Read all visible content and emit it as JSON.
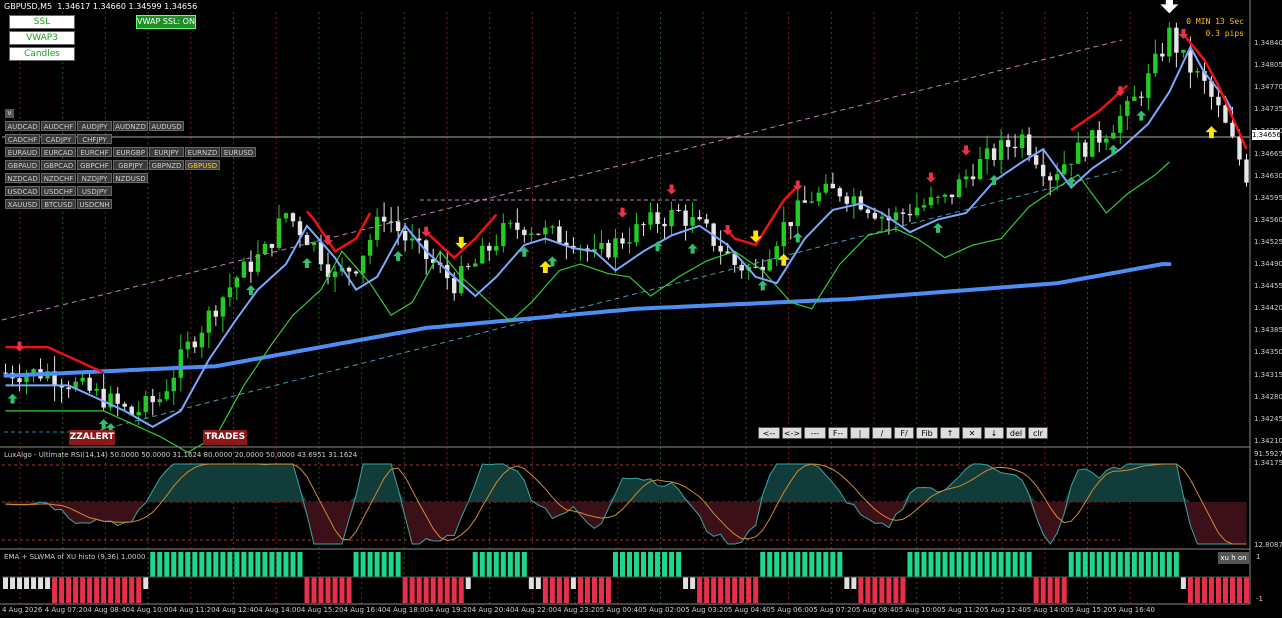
{
  "window": {
    "title": "GBPUSD,M5",
    "ohlc": "1.34617 1.34660 1.34599 1.34656"
  },
  "left_buttons": [
    "SSL",
    "VWAP3",
    "Candles"
  ],
  "vwap_button": "VWAP SSL: ON",
  "collapse_button": "v",
  "pair_rows": [
    [
      "AUDCAD",
      "AUDCHF",
      "AUDJPY",
      "AUDNZD",
      "AUDUSD"
    ],
    [
      "CADCHF",
      "CADJPY",
      "CHFJPY"
    ],
    [
      "EURAUD",
      "EURCAD",
      "EURCHF",
      "EURGBP",
      "EURJPY",
      "EURNZD",
      "EURUSD"
    ],
    [
      "GBPAUD",
      "GBPCAD",
      "GBPCHF",
      "GBPJPY",
      "GBPNZD",
      "GBPUSD"
    ],
    [
      "NZDCAD",
      "NZDCHF",
      "NZDJPY",
      "NZDUSD"
    ],
    [
      "USDCAD",
      "USDCHF",
      "USDJPY"
    ],
    [
      "XAUUSD",
      "BTCUSD",
      "USDCNH"
    ]
  ],
  "active_pair": "GBPUSD",
  "timer": {
    "line1": "0 MIN 13 Sec",
    "line2": "0.3 pips"
  },
  "alert_buttons": [
    "ZZALERT",
    "TRADES"
  ],
  "toolbar": [
    "<--",
    "<->",
    "---",
    "F--",
    "|",
    "/",
    "F/",
    "Fib",
    "↑",
    "✕",
    "↓",
    "del",
    "clr"
  ],
  "price_axis": {
    "labels": [
      "1.34840",
      "1.34805",
      "1.34770",
      "1.34735",
      "1.34700",
      "1.34665",
      "1.34630",
      "1.34595",
      "1.34560",
      "1.34525",
      "1.34490",
      "1.34455",
      "1.34420",
      "1.34385",
      "1.34350",
      "1.34315",
      "1.34280",
      "1.34245",
      "1.34210",
      "1.34175"
    ],
    "current": "1.34656"
  },
  "time_axis": [
    "4 Aug 2026",
    "4 Aug 07:20",
    "4 Aug 08:40",
    "4 Aug 10:00",
    "4 Aug 11:20",
    "4 Aug 12:40",
    "4 Aug 14:00",
    "4 Aug 15:20",
    "4 Aug 16:40",
    "4 Aug 18:00",
    "4 Aug 19:20",
    "4 Aug 20:40",
    "4 Aug 22:00",
    "4 Aug 23:20",
    "5 Aug 00:40",
    "5 Aug 02:00",
    "5 Aug 03:20",
    "5 Aug 04:40",
    "5 Aug 06:00",
    "5 Aug 07:20",
    "5 Aug 08:40",
    "5 Aug 10:00",
    "5 Aug 11:20",
    "5 Aug 12:40",
    "5 Aug 14:00",
    "5 Aug 15:20",
    "5 Aug 16:40"
  ],
  "rsi_panel": {
    "title": "LuxAlgo - Ultimate RSI(14,14) 50.0000 50.0000 31.1624 80.0000 20.0000 50.0000 43.6951 31.1624",
    "max_label": "91.5927",
    "min_label": "12.8087"
  },
  "histo_panel": {
    "title": "EMA + SLWMA of XU histo (9,36) 1.0000",
    "toggle": "xu h on",
    "max_label": "1",
    "min_label": "-1"
  },
  "colors": {
    "bg": "#000000",
    "bull": "#22cc22",
    "bear": "#e6e6e6",
    "ssl": "#ee1111",
    "vwap": "#4d8ef5",
    "ema": "#33cc33",
    "histo_up": "#1fd68f",
    "histo_down": "#e8304a",
    "histo_neutral": "#e0e0e0"
  },
  "chart_data": {
    "type": "candlestick",
    "symbol": "GBPUSD",
    "timeframe": "M5",
    "ylim": [
      1.34175,
      1.34855
    ],
    "close_path": [
      [
        0,
        1.3429
      ],
      [
        6,
        1.3429
      ],
      [
        10,
        1.3427
      ],
      [
        14,
        1.3425
      ],
      [
        18,
        1.34225
      ],
      [
        22,
        1.3425
      ],
      [
        26,
        1.3433
      ],
      [
        30,
        1.34395
      ],
      [
        33,
        1.3444
      ],
      [
        37,
        1.3448
      ],
      [
        40,
        1.3454
      ],
      [
        44,
        1.3449
      ],
      [
        47,
        1.3444
      ],
      [
        50,
        1.3446
      ],
      [
        54,
        1.3454
      ],
      [
        57,
        1.345
      ],
      [
        60,
        1.3447
      ],
      [
        64,
        1.3443
      ],
      [
        67,
        1.3446
      ],
      [
        71,
        1.3451
      ],
      [
        74,
        1.3452
      ],
      [
        78,
        1.34505
      ],
      [
        81,
        1.345
      ],
      [
        84,
        1.3447
      ],
      [
        88,
        1.345
      ],
      [
        92,
        1.34525
      ],
      [
        96,
        1.3454
      ],
      [
        100,
        1.3451
      ],
      [
        104,
        1.3446
      ],
      [
        107,
        1.3445
      ],
      [
        111,
        1.3452
      ],
      [
        115,
        1.34565
      ],
      [
        119,
        1.34575
      ],
      [
        122,
        1.3456
      ],
      [
        126,
        1.3453
      ],
      [
        130,
        1.3455
      ],
      [
        134,
        1.3456
      ],
      [
        138,
        1.3461
      ],
      [
        142,
        1.3464
      ],
      [
        145,
        1.3466
      ],
      [
        149,
        1.346
      ],
      [
        152,
        1.3463
      ],
      [
        156,
        1.3466
      ],
      [
        160,
        1.347
      ],
      [
        163,
        1.3475
      ],
      [
        166,
        1.3482
      ],
      [
        168,
        1.3478
      ],
      [
        171,
        1.3474
      ],
      [
        173,
        1.347
      ],
      [
        175,
        1.3465
      ],
      [
        177,
        1.346
      ]
    ],
    "vwap_path": [
      [
        0,
        1.34285
      ],
      [
        30,
        1.343
      ],
      [
        60,
        1.3436
      ],
      [
        90,
        1.3439
      ],
      [
        120,
        1.34405
      ],
      [
        150,
        1.3443
      ],
      [
        165,
        1.3446
      ]
    ],
    "ssl_up_signals": [
      1,
      14,
      15,
      35,
      43,
      56,
      74,
      78,
      93,
      98,
      108,
      113,
      133,
      141,
      152,
      158,
      162
    ],
    "ssl_down_signals": [
      2,
      46,
      60,
      88,
      95,
      103,
      113,
      132,
      137,
      159,
      168
    ],
    "yellow_up_signals": [
      77,
      111,
      172
    ],
    "yellow_down_signals": [
      65,
      107
    ]
  }
}
